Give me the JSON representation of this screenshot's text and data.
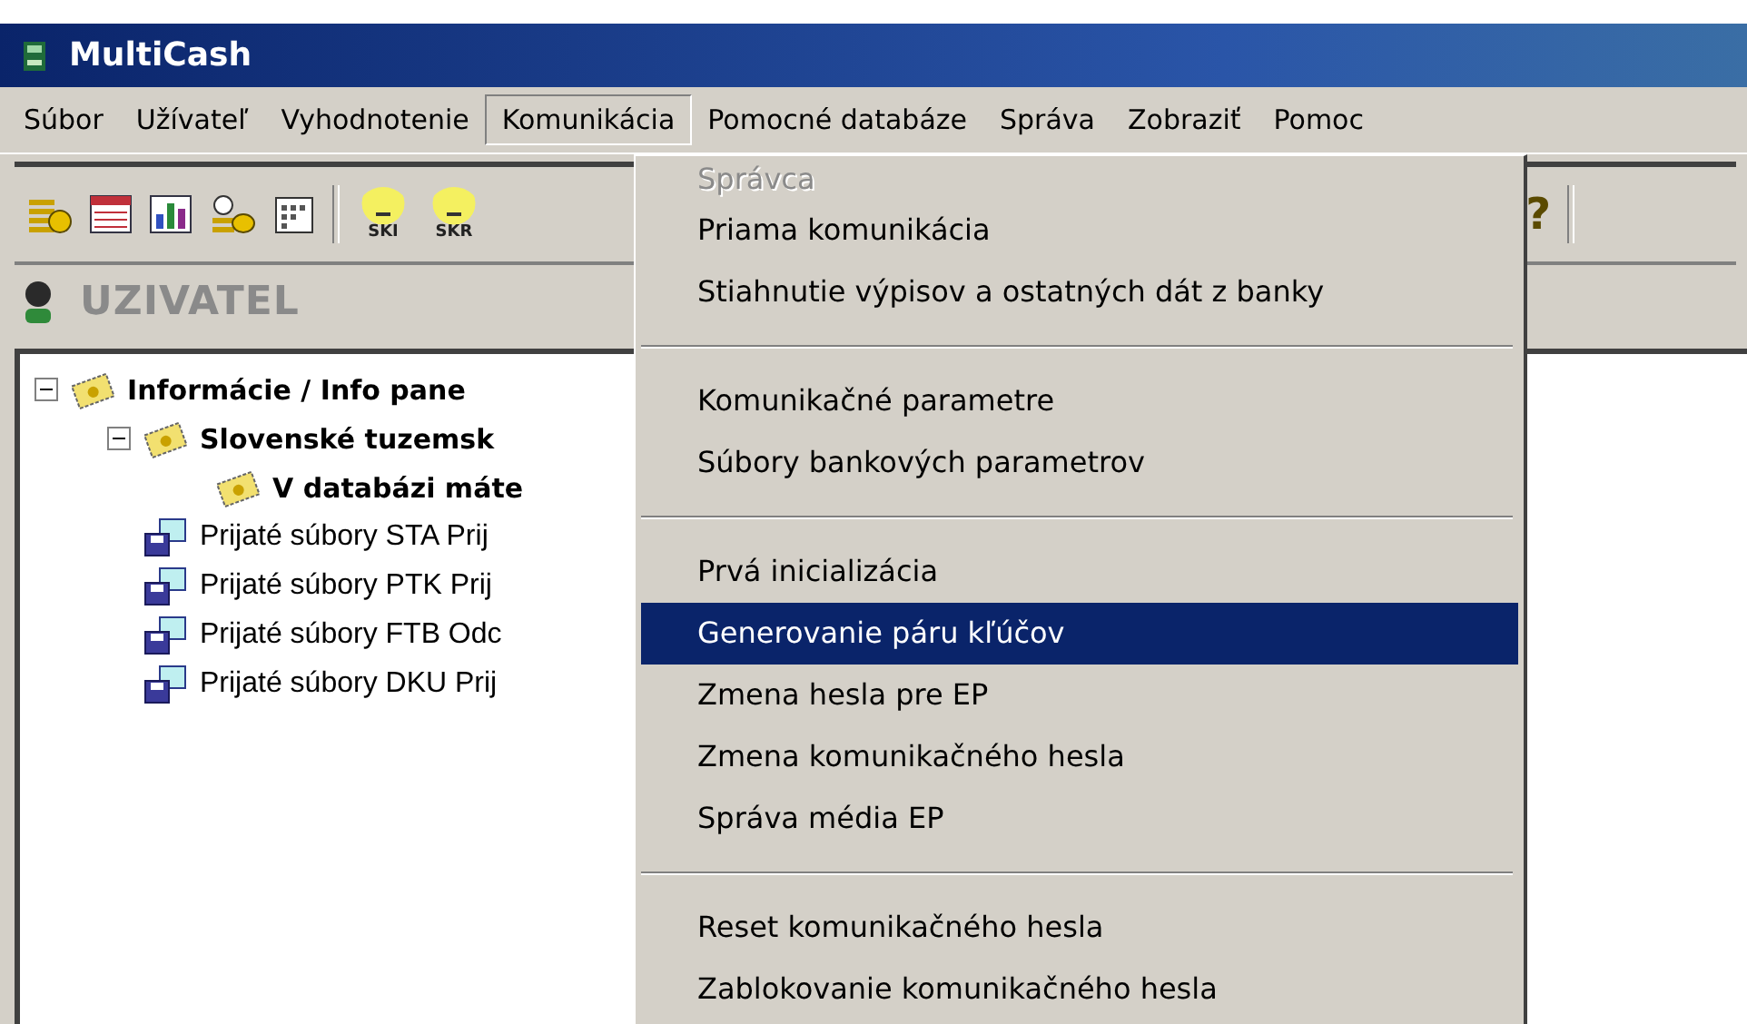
{
  "window": {
    "title": "MultiCash"
  },
  "menu_bar": [
    {
      "label": "Súbor",
      "selected": false
    },
    {
      "label": "Užívateľ",
      "selected": false
    },
    {
      "label": "Vyhodnotenie",
      "selected": false
    },
    {
      "label": "Komunikácia",
      "selected": true
    },
    {
      "label": "Pomocné databáze",
      "selected": false
    },
    {
      "label": "Správa",
      "selected": false
    },
    {
      "label": "Zobraziť",
      "selected": false
    },
    {
      "label": "Pomoc",
      "selected": false
    }
  ],
  "toolbar": [
    {
      "kind": "coins"
    },
    {
      "kind": "table"
    },
    {
      "kind": "chart"
    },
    {
      "kind": "clock-coins"
    },
    {
      "kind": "calendar"
    },
    {
      "kind": "separator"
    },
    {
      "kind": "badge",
      "label": "SKI"
    },
    {
      "kind": "badge",
      "label": "SKR"
    }
  ],
  "help_glyph": "?",
  "user": {
    "name": "UZIVATEL"
  },
  "tree": [
    {
      "label": "Informácie / Info pane",
      "kind": "info",
      "expanded": true,
      "children": [
        {
          "label": "Slovenské tuzemsk",
          "kind": "info",
          "expanded": true,
          "children": [
            {
              "label": "V databázi máte",
              "kind": "info"
            }
          ]
        },
        {
          "label": "Prijaté súbory STA Prij",
          "kind": "file"
        },
        {
          "label": "Prijaté súbory PTK Prij",
          "kind": "file"
        },
        {
          "label": "Prijaté súbory FTB Odc",
          "kind": "file"
        },
        {
          "label": "Prijaté súbory DKU Prij",
          "kind": "file"
        }
      ]
    }
  ],
  "dropdown": [
    {
      "kind": "item",
      "label": "Správca",
      "disabled": true,
      "selected": false
    },
    {
      "kind": "item",
      "label": "Priama komunikácia",
      "disabled": false,
      "selected": false
    },
    {
      "kind": "item",
      "label": "Stiahnutie výpisov a ostatných dát z banky",
      "disabled": false,
      "selected": false
    },
    {
      "kind": "separator"
    },
    {
      "kind": "item",
      "label": "Komunikačné parametre",
      "disabled": false,
      "selected": false
    },
    {
      "kind": "item",
      "label": "Súbory bankových parametrov",
      "disabled": false,
      "selected": false
    },
    {
      "kind": "separator"
    },
    {
      "kind": "item",
      "label": "Prvá inicializácia",
      "disabled": false,
      "selected": false
    },
    {
      "kind": "item",
      "label": "Generovanie páru kľúčov",
      "disabled": false,
      "selected": true
    },
    {
      "kind": "item",
      "label": "Zmena hesla pre EP",
      "disabled": false,
      "selected": false
    },
    {
      "kind": "item",
      "label": "Zmena komunikačného hesla",
      "disabled": false,
      "selected": false
    },
    {
      "kind": "item",
      "label": "Správa média EP",
      "disabled": false,
      "selected": false
    },
    {
      "kind": "separator"
    },
    {
      "kind": "item",
      "label": "Reset komunikačného hesla",
      "disabled": false,
      "selected": false
    },
    {
      "kind": "item",
      "label": "Zablokovanie komunikačného hesla",
      "disabled": false,
      "selected": false
    }
  ]
}
